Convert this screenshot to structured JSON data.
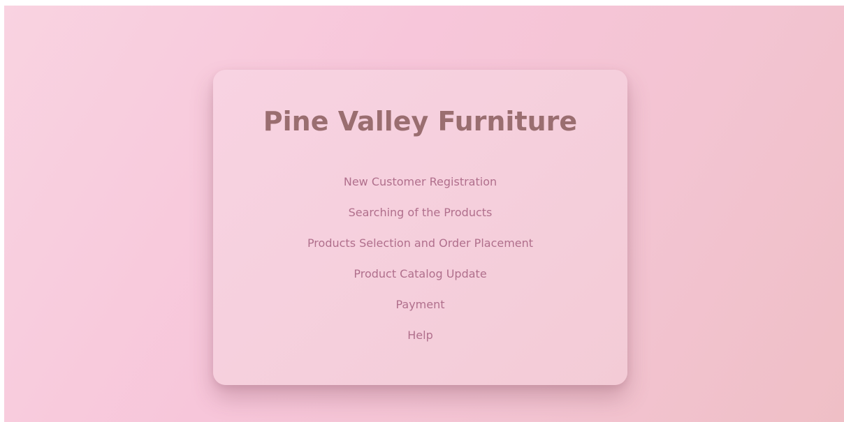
{
  "card": {
    "title": "Pine Valley Furniture",
    "menu": [
      "New Customer Registration",
      "Searching of the Products",
      "Products Selection and Order Placement",
      "Product Catalog Update",
      "Payment",
      "Help"
    ]
  }
}
